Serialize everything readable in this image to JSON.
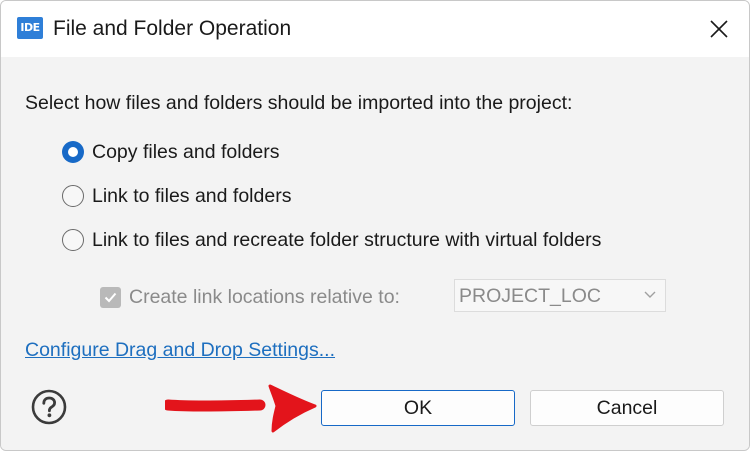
{
  "window": {
    "app_icon_text": "IDE",
    "title": "File and Folder Operation",
    "close_icon": "close-icon"
  },
  "content": {
    "instructions": "Select how files and folders should be imported into the project:",
    "options": [
      {
        "label": "Copy files and folders",
        "selected": true
      },
      {
        "label": "Link to files and folders",
        "selected": false
      },
      {
        "label": "Link to files and recreate folder structure with virtual folders",
        "selected": false
      }
    ],
    "link_locations": {
      "checkbox_label": "Create link locations relative to:",
      "checked": true,
      "enabled": false,
      "dropdown_value": "PROJECT_LOC"
    },
    "settings_link": "Configure Drag and Drop Settings..."
  },
  "footer": {
    "help_icon": "help-icon",
    "ok_label": "OK",
    "cancel_label": "Cancel"
  },
  "annotation": {
    "arrow_color": "#e3141b"
  },
  "colors": {
    "accent": "#1769c7",
    "link": "#1e6fbf",
    "disabled_text": "#8a8a8a"
  }
}
